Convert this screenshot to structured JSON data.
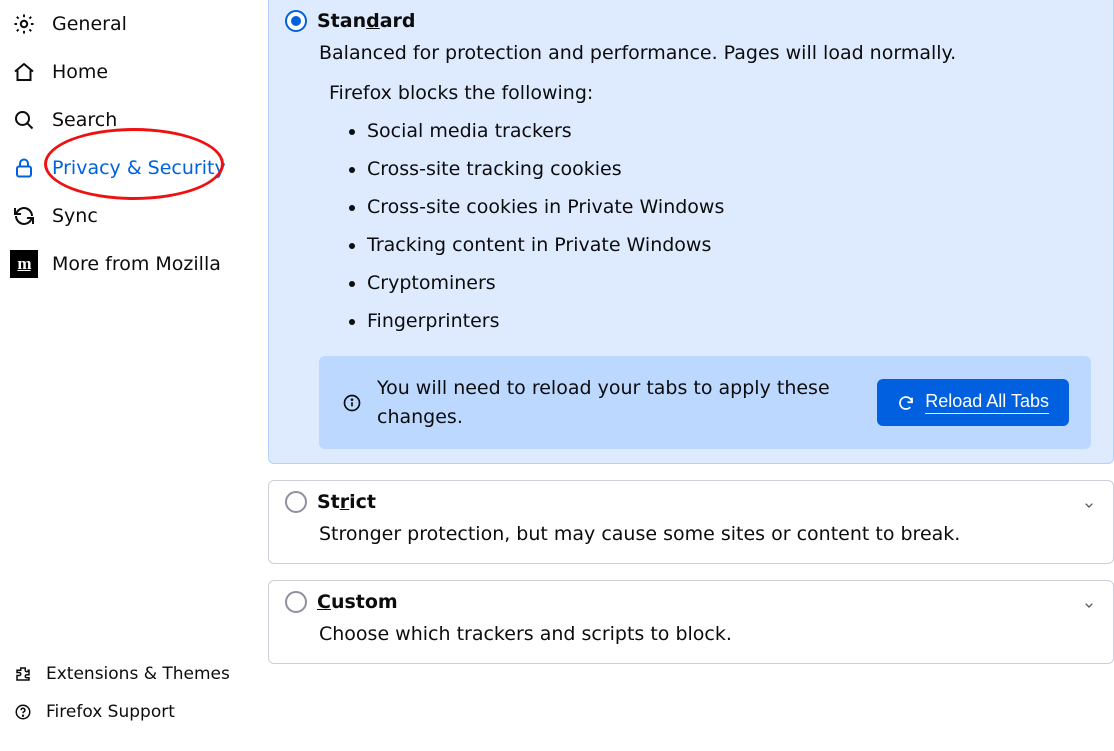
{
  "sidebar": {
    "items": [
      {
        "label": "General"
      },
      {
        "label": "Home"
      },
      {
        "label": "Search"
      },
      {
        "label": "Privacy & Security"
      },
      {
        "label": "Sync"
      },
      {
        "label": "More from Mozilla"
      }
    ],
    "bottom": [
      {
        "label": "Extensions & Themes"
      },
      {
        "label": "Firefox Support"
      }
    ]
  },
  "tracking": {
    "standard": {
      "title": "Standard",
      "desc": "Balanced for protection and performance. Pages will load normally.",
      "blocks_heading": "Firefox blocks the following:",
      "blocks": [
        "Social media trackers",
        "Cross-site tracking cookies",
        "Cross-site cookies in Private Windows",
        "Tracking content in Private Windows",
        "Cryptominers",
        "Fingerprinters"
      ],
      "reload_msg": "You will need to reload your tabs to apply these changes.",
      "reload_button": "Reload All Tabs"
    },
    "strict": {
      "title_pre": "St",
      "title_u": "r",
      "title_post": "ict",
      "desc": "Stronger protection, but may cause some sites or content to break."
    },
    "custom": {
      "title_pre": "",
      "title_u": "C",
      "title_post": "ustom",
      "desc": "Choose which trackers and scripts to block."
    }
  },
  "annotation": {
    "highlight_target": "Privacy & Security"
  }
}
